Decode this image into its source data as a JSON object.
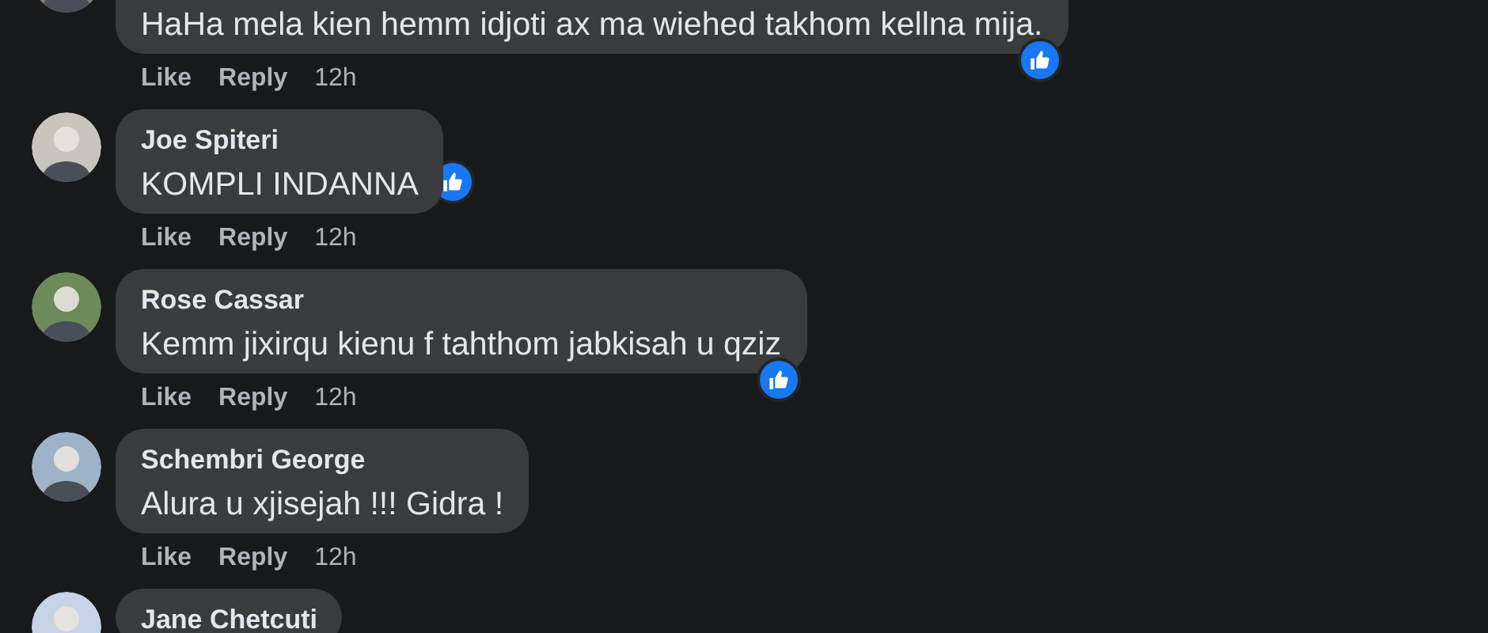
{
  "comments": [
    {
      "text": "HaHa mela kien hemm idjoti ax ma wiehed takhom kellna mija.",
      "liked": true,
      "kind": "wide",
      "actions": [
        "Like",
        "Reply"
      ],
      "time": "12h"
    },
    {
      "name": "Joe Spiteri",
      "text": "KOMPLI INDANNA",
      "liked": true,
      "kind": "short",
      "actions": [
        "Like",
        "Reply"
      ],
      "time": "12h"
    },
    {
      "name": "Rose Cassar",
      "text": "Kemm jixirqu kienu f tahthom jabkisah u qziz",
      "liked": true,
      "kind": "wide",
      "actions": [
        "Like",
        "Reply"
      ],
      "time": "12h"
    },
    {
      "name": "Schembri George",
      "text": "Alura u xjisejah !!! Gidra !",
      "liked": false,
      "kind": "short",
      "actions": [
        "Like",
        "Reply"
      ],
      "time": "12h"
    },
    {
      "name": "Jane Chetcuti"
    }
  ]
}
